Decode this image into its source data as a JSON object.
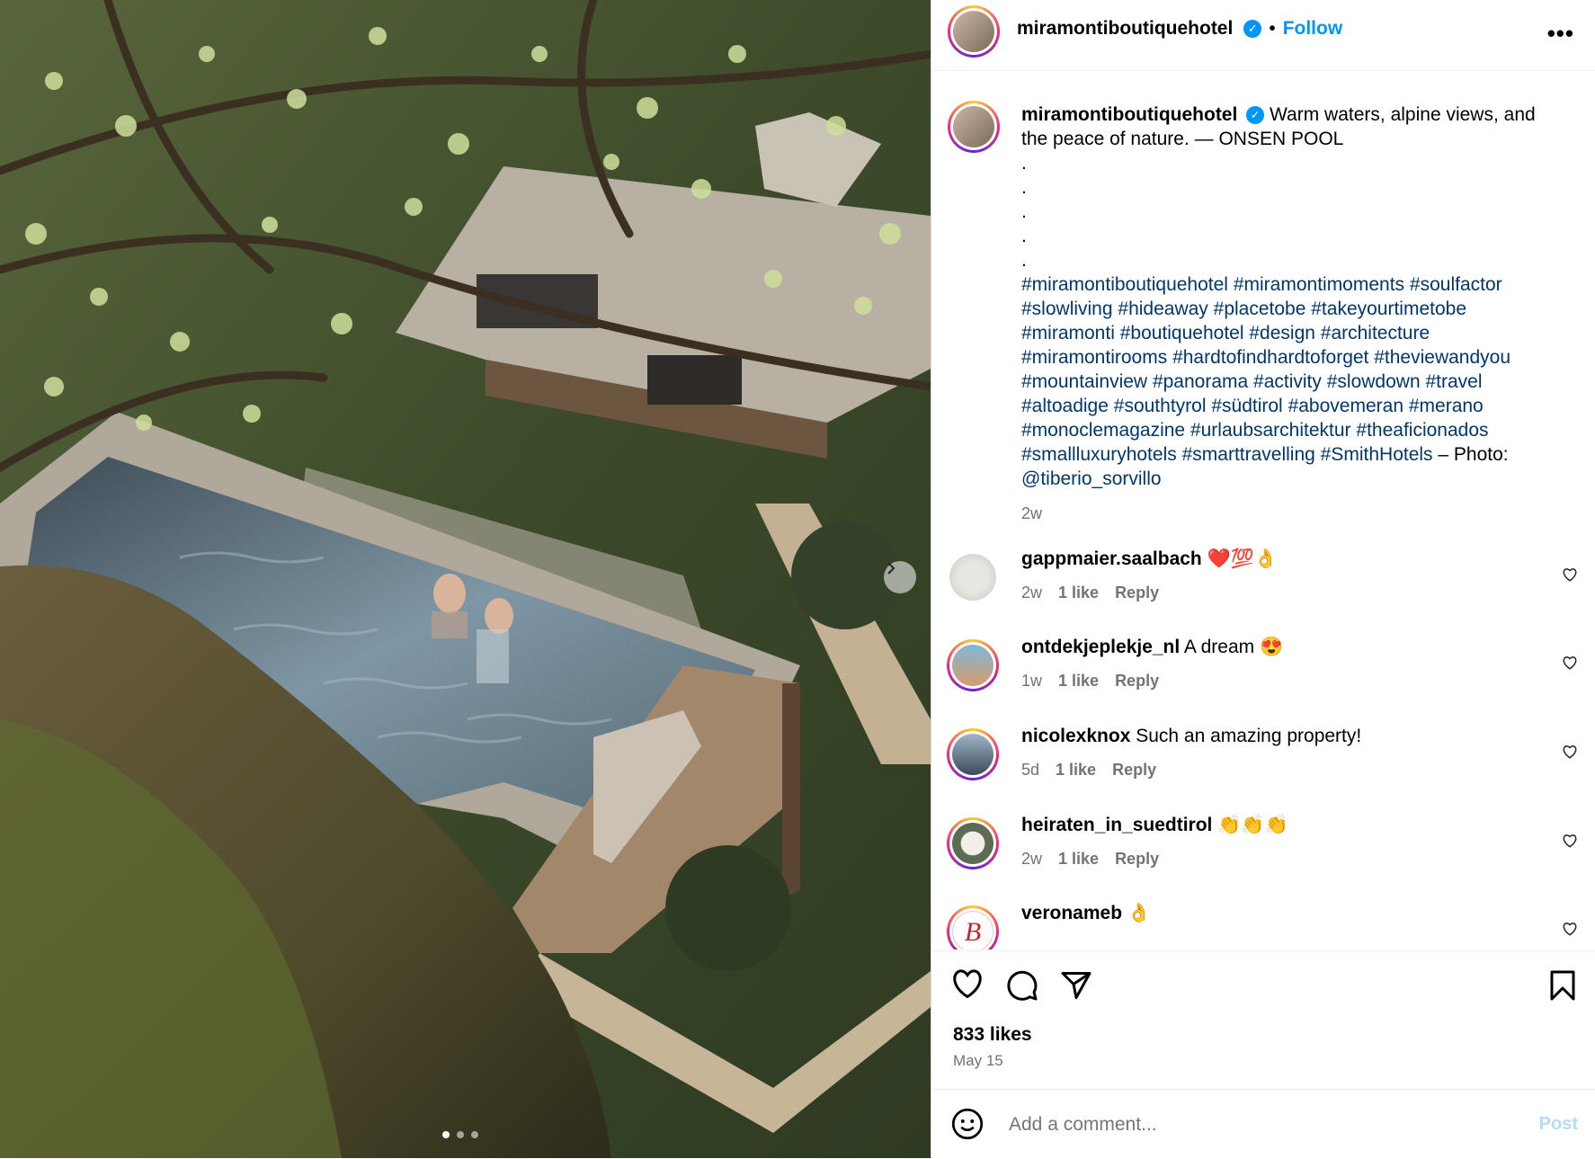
{
  "header": {
    "username": "miramontiboutiquehotel",
    "separator": "•",
    "follow_label": "Follow",
    "more_label": "•••"
  },
  "caption": {
    "username": "miramontiboutiquehotel",
    "text": "Warm waters, alpine views, and the peace of nature. — ONSEN POOL",
    "dots": [
      ".",
      ".",
      ".",
      ".",
      "."
    ],
    "hashtag_lines": [
      [
        "#miramontiboutiquehotel",
        "#miramontimoments",
        "#soulfactor"
      ],
      [
        "#slowliving",
        "#hideaway",
        "#placetobe",
        "#takeyourtimetobe"
      ],
      [
        "#miramonti",
        "#boutiquehotel",
        "#design",
        "#architecture"
      ],
      [
        "#miramontirooms",
        "#hardtofindhardtoforget",
        "#theviewandyou"
      ],
      [
        "#mountainview",
        "#panorama",
        "#activity",
        "#slowdown",
        "#travel"
      ],
      [
        "#altoadige",
        "#southtyrol",
        "#südtirol",
        "#abovemeran",
        "#merano"
      ],
      [
        "#monoclemagazine",
        "#urlaubsarchitektur",
        "#theaficionados"
      ],
      [
        "#smallluxuryhotels",
        "#smarttravelling",
        "#SmithHotels"
      ]
    ],
    "photo_credit_prefix": "– Photo:",
    "photo_credit_handle": "@tiberio_sorvillo",
    "time": "2w"
  },
  "comments": [
    {
      "user": "gappmaier.saalbach",
      "text": "❤️💯👌",
      "time": "2w",
      "likes": "1 like",
      "reply": "Reply"
    },
    {
      "user": "ontdekjeplekje_nl",
      "text": "A dream 😍",
      "time": "1w",
      "likes": "1 like",
      "reply": "Reply"
    },
    {
      "user": "nicolexknox",
      "text": "Such an amazing property!",
      "time": "5d",
      "likes": "1 like",
      "reply": "Reply"
    },
    {
      "user": "heiraten_in_suedtirol",
      "text": "👏👏👏",
      "time": "2w",
      "likes": "1 like",
      "reply": "Reply"
    },
    {
      "user": "veronameb",
      "text": "👌",
      "time": "",
      "likes": "",
      "reply": ""
    }
  ],
  "stats": {
    "likes": "833 likes",
    "date": "May 15"
  },
  "add_comment": {
    "placeholder": "Add a comment...",
    "post_label": "Post"
  },
  "carousel": {
    "dot_count": 3,
    "active_index": 0
  },
  "colors": {
    "link": "#00376b",
    "accent": "#0095f6",
    "meta": "#737373"
  }
}
